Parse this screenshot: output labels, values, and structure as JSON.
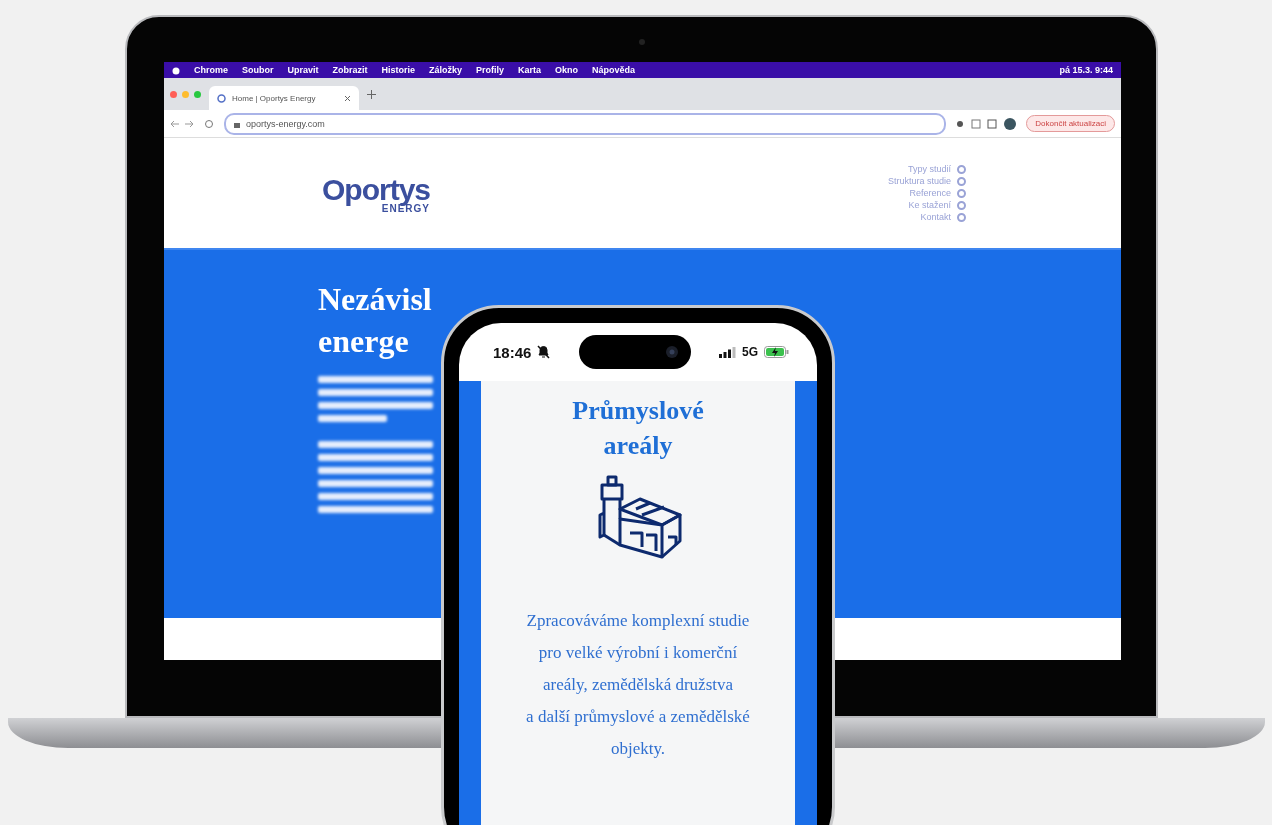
{
  "laptop": {
    "menu_bar": {
      "items": [
        "Chrome",
        "Soubor",
        "Upravit",
        "Zobrazit",
        "Historie",
        "Záložky",
        "Profily",
        "Karta",
        "Okno",
        "Nápověda"
      ],
      "clock": "pá 15.3. 9:44"
    },
    "browser": {
      "tab_title": "Home | Oportys Energy",
      "url": "oportys-energy.com",
      "update_button": "Dokončit aktualizaci"
    },
    "site": {
      "logo": "Oportys",
      "logo_sub": "ENERGY",
      "nav": [
        "Typy studií",
        "Struktura studie",
        "Reference",
        "Ke stažení",
        "Kontakt"
      ],
      "hero_title": [
        "Nezávisl",
        "energe"
      ]
    }
  },
  "phone": {
    "time": "18:46",
    "network": "5G",
    "card": {
      "title": "Průmyslové areály",
      "description": "Zpracováváme komplexní studie pro velké výrobní i komerční areály, zemědělská družstva\na další průmyslové a zemědělské objekty."
    }
  }
}
